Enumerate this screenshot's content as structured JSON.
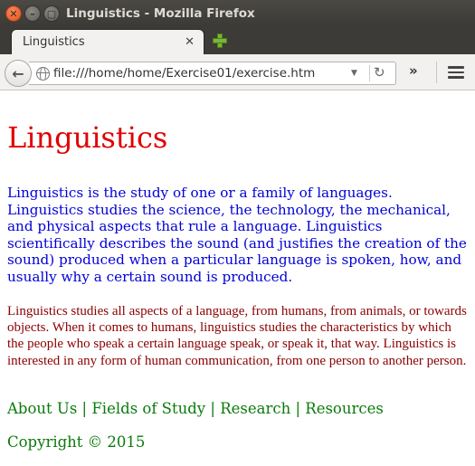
{
  "window": {
    "title": "Linguistics - Mozilla Firefox",
    "close_glyph": "✕",
    "minimize_glyph": "–",
    "maximize_glyph": "▢"
  },
  "tab": {
    "label": "Linguistics",
    "close_glyph": "✕"
  },
  "navbar": {
    "back_glyph": "←",
    "url": "file:///home/home/Exercise01/exercise.htm",
    "dropdown_glyph": "▼",
    "reload_glyph": "↻",
    "overflow_glyph": "»"
  },
  "page": {
    "title": "Linguistics",
    "intro": "Linguistics is the study of one or a family of languages. Linguistics studies the science, the technology, the mechanical, and physical aspects that rule a language. Linguistics scientifically describes the sound (and justifies the creation of the sound) produced when a particular language is spoken, how, and usually why a certain sound is produced.",
    "detail": "Linguistics studies all aspects of a language, from humans, from animals, or towards objects. When it comes to humans, linguistics studies the characteristics by which the people who speak a certain language speak, or speak it, that way. Linguistics is interested in any form of human communication, from one person to another person.",
    "nav": {
      "about": "About Us",
      "fields": "Fields of Study",
      "research": "Research",
      "resources": "Resources",
      "separator": " | "
    },
    "copyright": "Copyright © 2015"
  },
  "colors": {
    "title": "#e00000",
    "intro": "#0000d8",
    "detail": "#8b0000",
    "links": "#0a7a0a"
  },
  "icons": {
    "globe": "globe-icon",
    "reload": "reload-icon",
    "menu": "hamburger-menu-icon",
    "new_tab": "plus-icon"
  }
}
